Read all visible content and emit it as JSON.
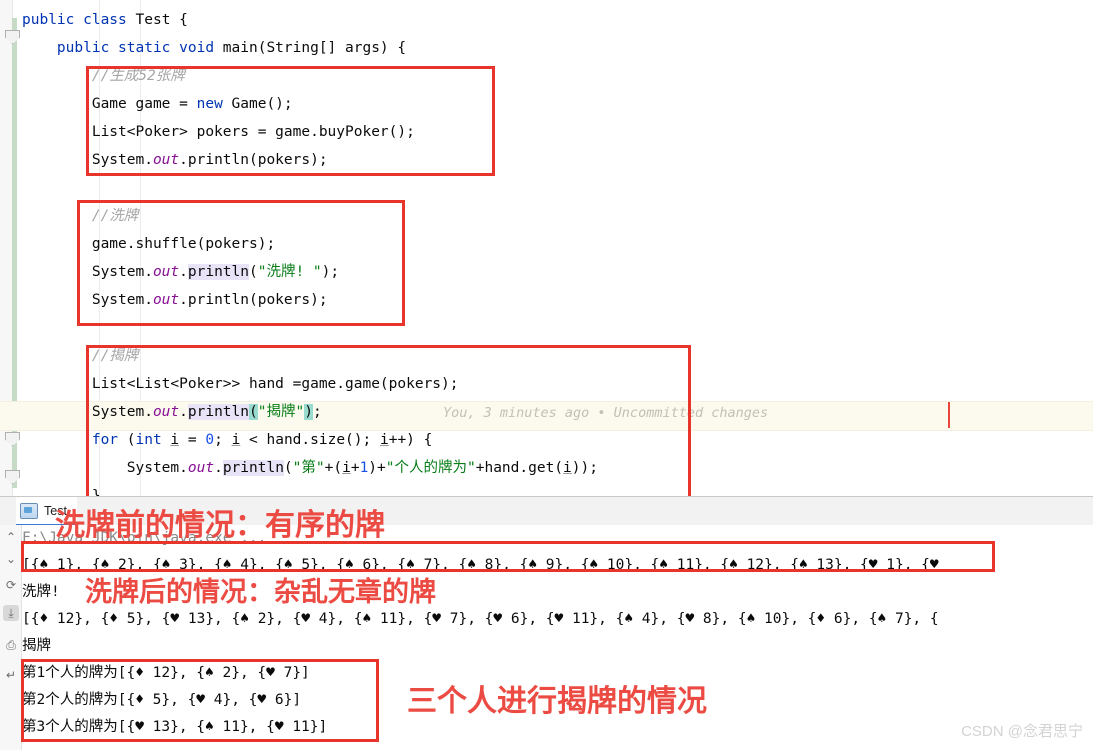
{
  "editor": {
    "lines": [
      {
        "id": "l1",
        "indent": 0,
        "tokens": [
          {
            "t": "public ",
            "c": "kw"
          },
          {
            "t": "class ",
            "c": "kw"
          },
          {
            "t": "Test {",
            "c": ""
          }
        ]
      },
      {
        "id": "l2",
        "indent": 1,
        "tokens": [
          {
            "t": "public ",
            "c": "kw"
          },
          {
            "t": "static ",
            "c": "kw"
          },
          {
            "t": "void ",
            "c": "kw"
          },
          {
            "t": "main(String[] args) {",
            "c": ""
          }
        ]
      },
      {
        "id": "l3",
        "indent": 2,
        "tokens": [
          {
            "t": "//生成52张牌",
            "c": "cmt"
          }
        ]
      },
      {
        "id": "l4",
        "indent": 2,
        "tokens": [
          {
            "t": "Game game = ",
            "c": ""
          },
          {
            "t": "new ",
            "c": "kw"
          },
          {
            "t": "Game();",
            "c": ""
          }
        ]
      },
      {
        "id": "l5",
        "indent": 2,
        "tokens": [
          {
            "t": "List<Poker> pokers = game.buyPoker();",
            "c": ""
          }
        ]
      },
      {
        "id": "l6",
        "indent": 2,
        "tokens": [
          {
            "t": "System.",
            "c": ""
          },
          {
            "t": "out",
            "c": "fld"
          },
          {
            "t": ".println(pokers);",
            "c": ""
          }
        ]
      },
      {
        "id": "l7",
        "indent": 0,
        "tokens": []
      },
      {
        "id": "l8",
        "indent": 2,
        "tokens": [
          {
            "t": "//洗牌",
            "c": "cmt"
          }
        ]
      },
      {
        "id": "l9",
        "indent": 2,
        "tokens": [
          {
            "t": "game.shuffle(pokers);",
            "c": ""
          }
        ]
      },
      {
        "id": "l10",
        "indent": 2,
        "tokens": [
          {
            "t": "System.",
            "c": ""
          },
          {
            "t": "out",
            "c": "fld"
          },
          {
            "t": ".",
            "c": ""
          },
          {
            "t": "println",
            "c": "hl-lavender"
          },
          {
            "t": "(",
            "c": ""
          },
          {
            "t": "\"洗牌! \"",
            "c": "str"
          },
          {
            "t": ");",
            "c": ""
          }
        ]
      },
      {
        "id": "l11",
        "indent": 2,
        "tokens": [
          {
            "t": "System.",
            "c": ""
          },
          {
            "t": "out",
            "c": "fld"
          },
          {
            "t": ".println(pokers);",
            "c": ""
          }
        ]
      },
      {
        "id": "l12",
        "indent": 0,
        "tokens": []
      },
      {
        "id": "l13",
        "indent": 2,
        "tokens": [
          {
            "t": "//揭牌",
            "c": "cmt"
          }
        ]
      },
      {
        "id": "l14",
        "indent": 2,
        "tokens": [
          {
            "t": "List<List<Poker>> hand =game.game(pokers);",
            "c": ""
          }
        ]
      },
      {
        "id": "l15",
        "indent": 2,
        "tokens": [
          {
            "t": "System.",
            "c": ""
          },
          {
            "t": "out",
            "c": "fld"
          },
          {
            "t": ".",
            "c": ""
          },
          {
            "t": "println",
            "c": "hl-lavender"
          },
          {
            "t": "(",
            "c": "hl-teal"
          },
          {
            "t": "\"揭牌\"",
            "c": "str"
          },
          {
            "t": ")",
            "c": "hl-teal"
          },
          {
            "t": ";",
            "c": ""
          }
        ]
      },
      {
        "id": "l16",
        "indent": 2,
        "tokens": [
          {
            "t": "for ",
            "c": "kw"
          },
          {
            "t": "(",
            "c": ""
          },
          {
            "t": "int ",
            "c": "kw"
          },
          {
            "t": "i",
            "c": "und"
          },
          {
            "t": " = ",
            "c": ""
          },
          {
            "t": "0",
            "c": "num"
          },
          {
            "t": "; ",
            "c": ""
          },
          {
            "t": "i",
            "c": "und"
          },
          {
            "t": " < hand.size(); ",
            "c": ""
          },
          {
            "t": "i",
            "c": "und"
          },
          {
            "t": "++) {",
            "c": ""
          }
        ]
      },
      {
        "id": "l17",
        "indent": 3,
        "tokens": [
          {
            "t": "System.",
            "c": ""
          },
          {
            "t": "out",
            "c": "fld"
          },
          {
            "t": ".",
            "c": ""
          },
          {
            "t": "println",
            "c": "hl-lavender"
          },
          {
            "t": "(",
            "c": ""
          },
          {
            "t": "\"第\"",
            "c": "str"
          },
          {
            "t": "+(",
            "c": ""
          },
          {
            "t": "i",
            "c": "und"
          },
          {
            "t": "+",
            "c": ""
          },
          {
            "t": "1",
            "c": "num"
          },
          {
            "t": ")+",
            "c": ""
          },
          {
            "t": "\"个人的牌为\"",
            "c": "str"
          },
          {
            "t": "+hand.get(",
            "c": ""
          },
          {
            "t": "i",
            "c": "und"
          },
          {
            "t": "));",
            "c": ""
          }
        ]
      },
      {
        "id": "l18",
        "indent": 2,
        "tokens": [
          {
            "t": "}",
            "c": ""
          }
        ]
      }
    ],
    "blame": "You, 3 minutes ago • Uncommitted changes"
  },
  "run_panel": {
    "tab_label": "Test",
    "tab_icon": "run-configuration-icon",
    "toolbar_icons": [
      {
        "name": "expand-up-icon",
        "glyph": "⌃"
      },
      {
        "name": "expand-down-icon",
        "glyph": "⌄"
      },
      {
        "name": "rerun-icon",
        "glyph": "⟳"
      },
      {
        "name": "scroll-to-end-icon",
        "glyph": "⤓"
      },
      {
        "name": "print-icon",
        "glyph": "⎙"
      },
      {
        "name": "soft-wrap-icon",
        "glyph": "↵"
      }
    ],
    "console_lines": [
      {
        "id": "c1",
        "cls": "cpath",
        "text": "F:\\Java JDK\\bin\\java.exe ..."
      },
      {
        "id": "c2",
        "cls": "",
        "text": "[{♠ 1}, {♠ 2}, {♠ 3}, {♠ 4}, {♠ 5}, {♠ 6}, {♠ 7}, {♠ 8}, {♠ 9}, {♠ 10}, {♠ 11}, {♠ 12}, {♠ 13}, {♥ 1}, {♥"
      },
      {
        "id": "c3",
        "cls": "",
        "text": "洗牌! "
      },
      {
        "id": "c4",
        "cls": "",
        "text": "[{♦ 12}, {♦ 5}, {♥ 13}, {♠ 2}, {♥ 4}, {♠ 11}, {♥ 7}, {♥ 6}, {♥ 11}, {♠ 4}, {♥ 8}, {♠ 10}, {♦ 6}, {♠ 7}, {"
      },
      {
        "id": "c5",
        "cls": "",
        "text": "揭牌"
      },
      {
        "id": "c6",
        "cls": "",
        "text": "第1个人的牌为[{♦ 12}, {♠ 2}, {♥ 7}]"
      },
      {
        "id": "c7",
        "cls": "",
        "text": "第2个人的牌为[{♦ 5}, {♥ 4}, {♥ 6}]"
      },
      {
        "id": "c8",
        "cls": "",
        "text": "第3个人的牌为[{♥ 13}, {♠ 11}, {♥ 11}]"
      }
    ]
  },
  "annotations": {
    "before_shuffle": "洗牌前的情况：有序的牌",
    "after_shuffle": "洗牌后的情况：杂乱无章的牌",
    "three_players": "三个人进行揭牌的情况"
  },
  "watermark": {
    "text": "CSDN @念君思宁"
  },
  "colors": {
    "annotation_red": "#ec4b43",
    "box_red": "#e8352b",
    "keyword_blue": "#0033b3",
    "string_green": "#067d17",
    "comment_gray": "#a5a5a5",
    "field_purple": "#871094",
    "number_blue": "#1750eb"
  }
}
